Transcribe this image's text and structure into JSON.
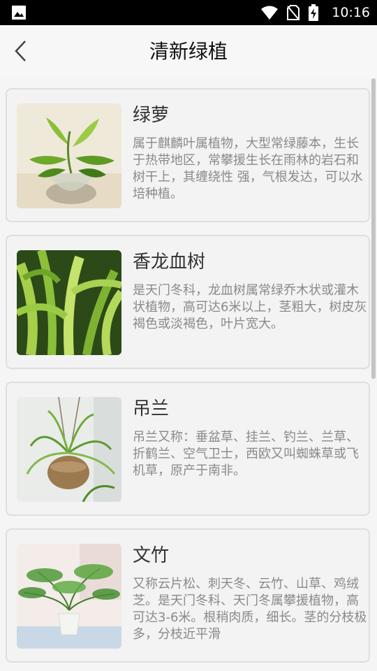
{
  "status_bar": {
    "time": "10:16",
    "icons": [
      "image-icon",
      "wifi-icon",
      "no-sim-icon",
      "battery-charging-icon"
    ]
  },
  "header": {
    "title": "清新绿植",
    "back_icon": "chevron-left-icon"
  },
  "plants": [
    {
      "name": "绿萝",
      "description": "属于麒麟叶属植物，大型常绿藤本，生长于热带地区，常攀援生长在雨林的岩石和树干上，其缠绕性 强，气根发达，可以水培种植。"
    },
    {
      "name": "香龙血树",
      "description": "是天门冬科，龙血树属常绿乔木状或灌木状植物，高可达6米以上，茎粗大，树皮灰褐色或淡褐色，叶片宽大。"
    },
    {
      "name": "吊兰",
      "description": "吊兰又称：垂盆草、挂兰、钓兰、兰草、折鹤兰、空气卫士，西欧又叫蜘蛛草或飞机草，原产于南非。"
    },
    {
      "name": "文竹",
      "description": "又称云片松、刺天冬、云竹、山草、鸡绒芝。是天门冬科、天门冬属攀援植物，高可达3-6米。根稍肉质，细长。茎的分枝极多，分枝近平滑"
    }
  ]
}
